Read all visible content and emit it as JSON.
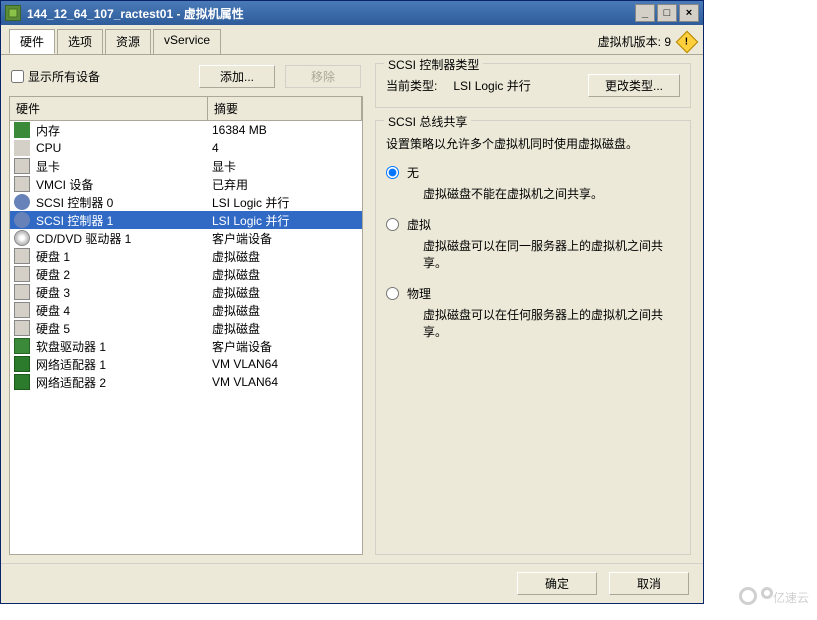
{
  "window": {
    "title": "144_12_64_107_ractest01 - 虚拟机属性"
  },
  "tabs": {
    "items": [
      {
        "label": "硬件",
        "active": true
      },
      {
        "label": "选项",
        "active": false
      },
      {
        "label": "资源",
        "active": false
      },
      {
        "label": "vService",
        "active": false
      }
    ],
    "vm_version_label": "虚拟机版本: 9"
  },
  "left": {
    "show_all_label": "显示所有设备",
    "show_all_checked": false,
    "add_btn": "添加...",
    "remove_btn": "移除",
    "columns": {
      "hw": "硬件",
      "summary": "摘要"
    },
    "rows": [
      {
        "icon": "ic-mem",
        "icon_name": "memory-icon",
        "name": "内存",
        "summary": "16384 MB",
        "selected": false
      },
      {
        "icon": "ic-cpu",
        "icon_name": "cpu-icon",
        "name": "CPU",
        "summary": "4",
        "selected": false
      },
      {
        "icon": "ic-video",
        "icon_name": "video-card-icon",
        "name": "显卡",
        "summary": "显卡",
        "selected": false
      },
      {
        "icon": "ic-vmci",
        "icon_name": "vmci-device-icon",
        "name": "VMCI 设备",
        "summary": "已弃用",
        "selected": false
      },
      {
        "icon": "ic-scsi",
        "icon_name": "scsi-controller-icon",
        "name": "SCSI 控制器 0",
        "summary": "LSI Logic 并行",
        "selected": false
      },
      {
        "icon": "ic-scsi",
        "icon_name": "scsi-controller-icon",
        "name": "SCSI 控制器 1",
        "summary": "LSI Logic 并行",
        "selected": true
      },
      {
        "icon": "ic-cd",
        "icon_name": "cd-dvd-icon",
        "name": "CD/DVD 驱动器 1",
        "summary": "客户端设备",
        "selected": false
      },
      {
        "icon": "ic-disk",
        "icon_name": "hard-disk-icon",
        "name": "硬盘 1",
        "summary": "虚拟磁盘",
        "selected": false
      },
      {
        "icon": "ic-disk",
        "icon_name": "hard-disk-icon",
        "name": "硬盘 2",
        "summary": "虚拟磁盘",
        "selected": false
      },
      {
        "icon": "ic-disk",
        "icon_name": "hard-disk-icon",
        "name": "硬盘 3",
        "summary": "虚拟磁盘",
        "selected": false
      },
      {
        "icon": "ic-disk",
        "icon_name": "hard-disk-icon",
        "name": "硬盘 4",
        "summary": "虚拟磁盘",
        "selected": false
      },
      {
        "icon": "ic-disk",
        "icon_name": "hard-disk-icon",
        "name": "硬盘 5",
        "summary": "虚拟磁盘",
        "selected": false
      },
      {
        "icon": "ic-floppy",
        "icon_name": "floppy-drive-icon",
        "name": "软盘驱动器 1",
        "summary": "客户端设备",
        "selected": false
      },
      {
        "icon": "ic-net",
        "icon_name": "network-adapter-icon",
        "name": "网络适配器 1",
        "summary": "VM VLAN64",
        "selected": false
      },
      {
        "icon": "ic-net",
        "icon_name": "network-adapter-icon",
        "name": "网络适配器 2",
        "summary": "VM VLAN64",
        "selected": false
      }
    ]
  },
  "right": {
    "type_group": {
      "legend": "SCSI 控制器类型",
      "label": "当前类型:",
      "value": "LSI Logic 并行",
      "change_btn": "更改类型..."
    },
    "share_group": {
      "legend": "SCSI 总线共享",
      "desc": "设置策略以允许多个虚拟机同时使用虚拟磁盘。",
      "options": [
        {
          "label": "无",
          "desc": "虚拟磁盘不能在虚拟机之间共享。",
          "checked": true
        },
        {
          "label": "虚拟",
          "desc": "虚拟磁盘可以在同一服务器上的虚拟机之间共享。",
          "checked": false
        },
        {
          "label": "物理",
          "desc": "虚拟磁盘可以在任何服务器上的虚拟机之间共享。",
          "checked": false
        }
      ]
    }
  },
  "footer": {
    "ok": "确定",
    "cancel": "取消"
  },
  "watermark": "亿速云"
}
